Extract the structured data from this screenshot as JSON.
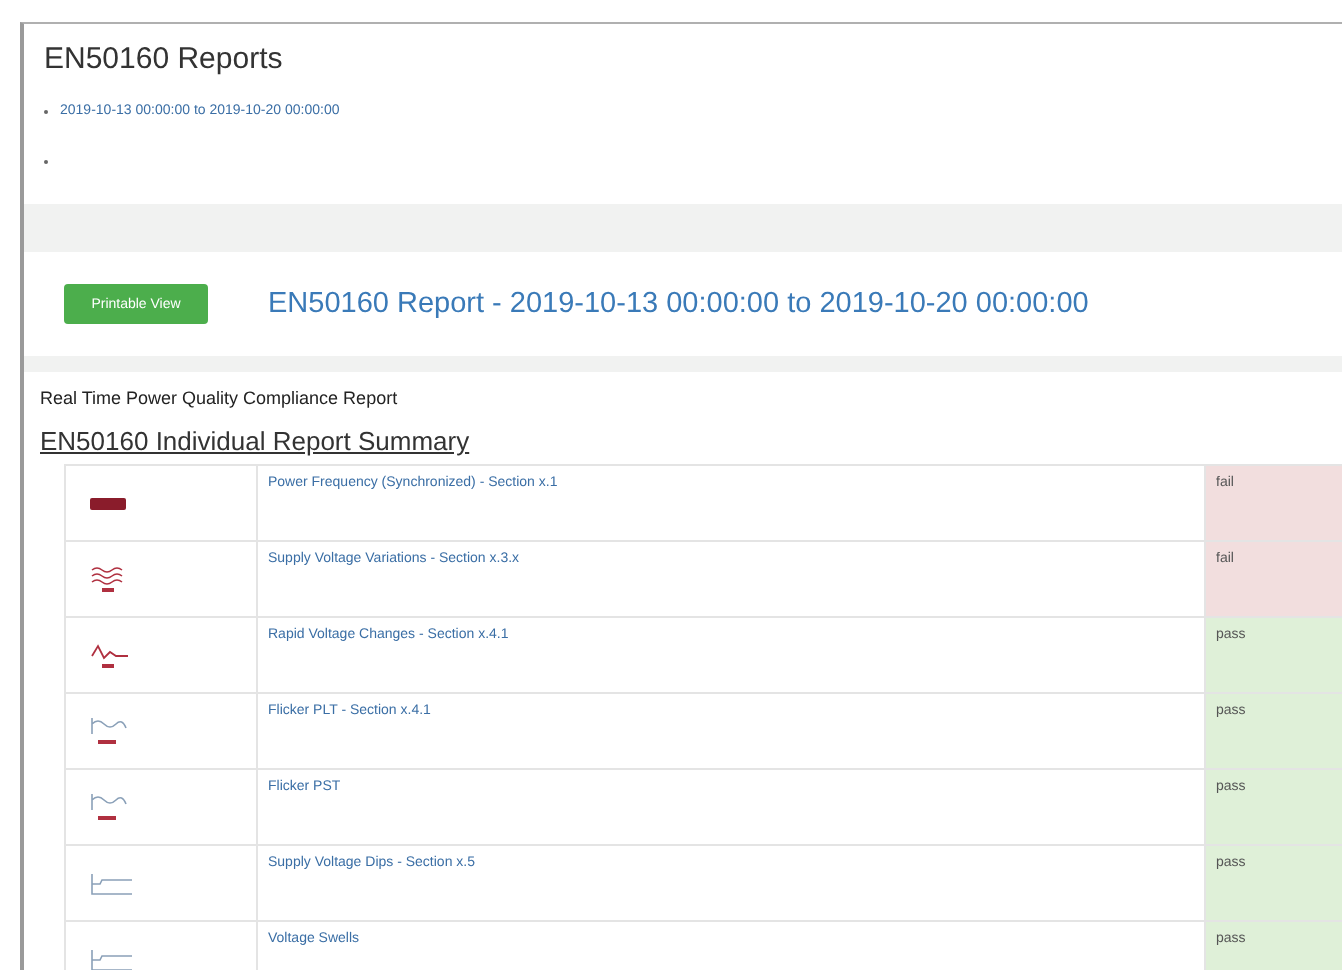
{
  "page_title": "EN50160 Reports",
  "report_links": [
    {
      "label": "2019-10-13 00:00:00 to 2019-10-20 00:00:00"
    },
    {
      "empty": true
    }
  ],
  "printable_button": "Printable View",
  "report_title": "EN50160 Report - 2019-10-13 00:00:00 to 2019-10-20 00:00:00",
  "subtitle": "Real Time Power Quality Compliance Report",
  "summary_heading": "EN50160 Individual Report Summary",
  "rows": [
    {
      "kind": "frequency",
      "name": "Power Frequency (Synchronized) - Section x.1",
      "result": "fail",
      "passed": false
    },
    {
      "kind": "variations",
      "name": "Supply Voltage Variations - Section x.3.x",
      "result": "fail",
      "passed": false
    },
    {
      "kind": "rapid",
      "name": "Rapid Voltage Changes - Section x.4.1",
      "result": "pass",
      "passed": true
    },
    {
      "kind": "flicker",
      "name": "Flicker PLT - Section x.4.1",
      "result": "pass",
      "passed": true
    },
    {
      "kind": "flicker",
      "name": "Flicker PST",
      "result": "pass",
      "passed": true
    },
    {
      "kind": "dips",
      "name": "Supply Voltage Dips - Section x.5",
      "result": "pass",
      "passed": true
    },
    {
      "kind": "dips",
      "name": "Voltage Swells",
      "result": "pass",
      "passed": true
    }
  ]
}
